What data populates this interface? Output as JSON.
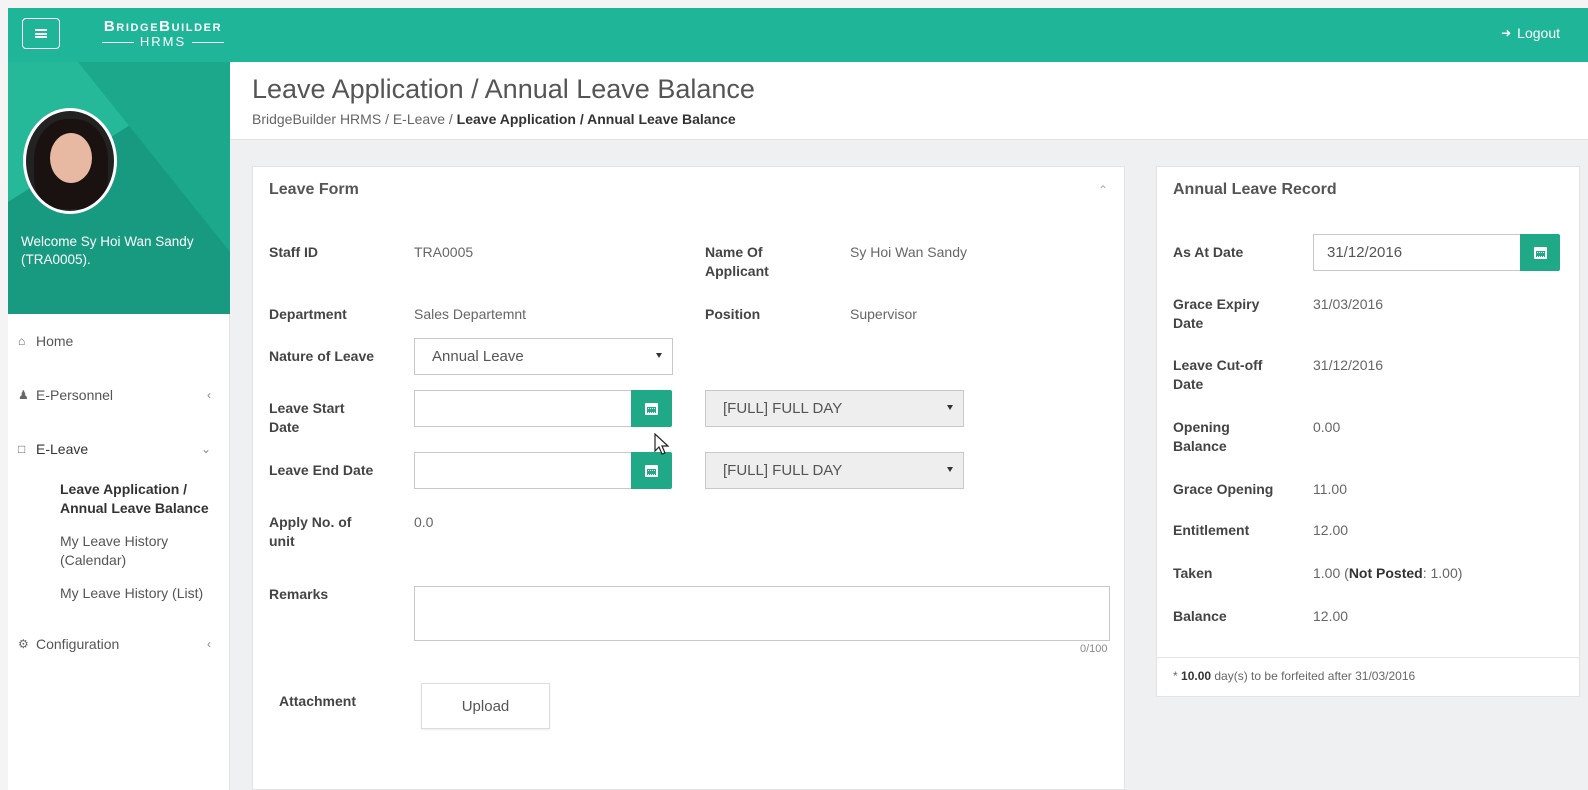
{
  "brand": {
    "line1": "BridgeBuilder",
    "line2": "HRMS"
  },
  "topbar": {
    "logout_label": "Logout"
  },
  "sidebar": {
    "welcome": "Welcome Sy Hoi Wan Sandy (TRA0005).",
    "items": [
      {
        "label": "Home",
        "icon": "home-icon"
      },
      {
        "label": "E-Personnel",
        "icon": "user-icon"
      },
      {
        "label": "E-Leave",
        "icon": "calendar-icon"
      },
      {
        "label": "Configuration",
        "icon": "cogs-icon"
      }
    ],
    "eleave_sub": [
      "Leave Application / Annual Leave Balance",
      "My Leave History (Calendar)",
      "My Leave History (List)"
    ]
  },
  "header": {
    "title": "Leave Application / Annual Leave Balance",
    "breadcrumb_1": "BridgeBuilder HRMS",
    "breadcrumb_2": "E-Leave",
    "breadcrumb_current": "Leave Application / Annual Leave Balance",
    "separator": "/"
  },
  "leave_form": {
    "title": "Leave Form",
    "staff_id_label": "Staff ID",
    "staff_id": "TRA0005",
    "applicant_label": "Name Of Applicant",
    "applicant": "Sy Hoi Wan Sandy",
    "department_label": "Department",
    "department": "Sales Departemnt",
    "position_label": "Position",
    "position": "Supervisor",
    "nature_label": "Nature of Leave",
    "nature_value": "Annual Leave",
    "start_label": "Leave Start Date",
    "start_value": "",
    "start_period": "[FULL] FULL DAY",
    "end_label": "Leave End Date",
    "end_value": "",
    "end_period": "[FULL] FULL DAY",
    "units_label": "Apply No. of unit",
    "units_value": "0.0",
    "remarks_label": "Remarks",
    "remarks_counter": "0/100",
    "attachment_label": "Attachment",
    "upload_label": "Upload"
  },
  "annual_record": {
    "title": "Annual Leave Record",
    "as_at_label": "As At Date",
    "as_at_value": "31/12/2016",
    "rows": [
      {
        "label": "Grace Expiry Date",
        "value": "31/03/2016"
      },
      {
        "label": "Leave Cut-off Date",
        "value": "31/12/2016"
      },
      {
        "label": "Opening Balance",
        "value": "0.00"
      },
      {
        "label": "Grace Opening",
        "value": "11.00"
      },
      {
        "label": "Entitlement",
        "value": "12.00"
      },
      {
        "label": "Taken",
        "value": "1.00"
      },
      {
        "label": "Balance",
        "value": "12.00"
      }
    ],
    "taken_open": "(",
    "not_posted_label": "Not Posted",
    "not_posted_value": ": 1.00)",
    "note_prefix": "* ",
    "note_days": "10.00",
    "note_text": " day(s) to be forfeited after 31/03/2016"
  },
  "colors": {
    "brand": "#1fb598",
    "accent_button": "#1fa987"
  }
}
